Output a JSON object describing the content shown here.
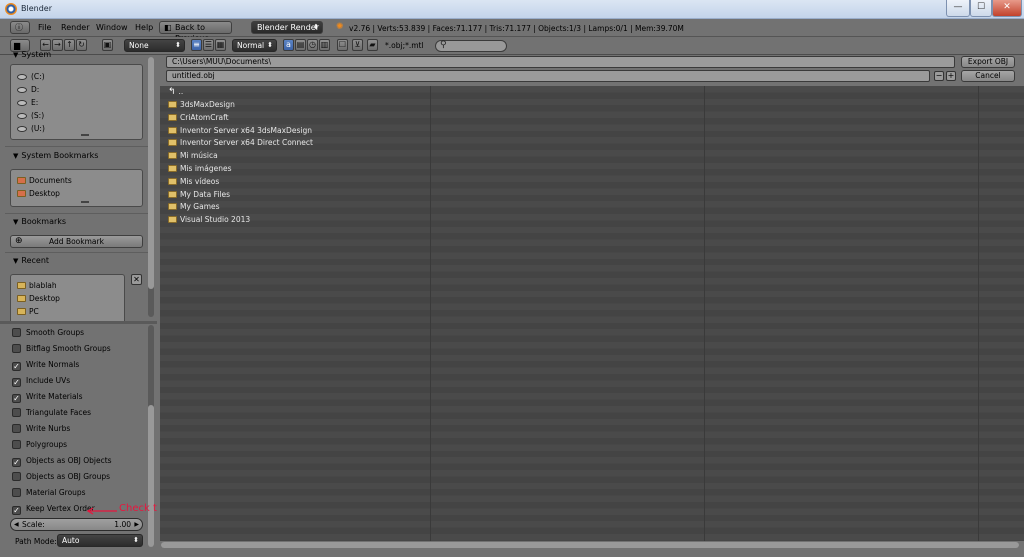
{
  "window": {
    "title": "Blender",
    "min": "—",
    "max": "☐",
    "close": "✕"
  },
  "info_header": {
    "menus": [
      "File",
      "Render",
      "Window",
      "Help"
    ],
    "back_button": "Back to Previous",
    "render_engine": "Blender Render",
    "stats": "v2.76 | Verts:53.839 | Faces:71.177 | Tris:71.177 | Objects:1/3 | Lamps:0/1 | Mem:39.70M"
  },
  "file_header": {
    "sort_select": "None",
    "display_select": "Normal",
    "filter_text": "*.obj;*.mtl",
    "search_placeholder": ""
  },
  "sidebar": {
    "volumes_header": "System",
    "drives": [
      "(C:)",
      "D:",
      "E:",
      "(S:)",
      "(U:)"
    ],
    "system_bookmarks_header": "System Bookmarks",
    "system_bookmarks": [
      "Documents",
      "Desktop"
    ],
    "bookmarks_header": "Bookmarks",
    "add_bookmark": "Add Bookmark",
    "recent_header": "Recent",
    "recent": [
      "blablah",
      "Desktop",
      "PC"
    ]
  },
  "options": [
    {
      "label": "Smooth Groups",
      "checked": false
    },
    {
      "label": "Bitflag Smooth Groups",
      "checked": false
    },
    {
      "label": "Write Normals",
      "checked": true
    },
    {
      "label": "Include UVs",
      "checked": true
    },
    {
      "label": "Write Materials",
      "checked": true
    },
    {
      "label": "Triangulate Faces",
      "checked": false
    },
    {
      "label": "Write Nurbs",
      "checked": false
    },
    {
      "label": "Polygroups",
      "checked": false
    },
    {
      "label": "Objects as OBJ Objects",
      "checked": true
    },
    {
      "label": "Objects as OBJ Groups",
      "checked": false
    },
    {
      "label": "Material Groups",
      "checked": false
    },
    {
      "label": "Keep Vertex Order",
      "checked": true
    }
  ],
  "scale": {
    "label": "Scale:",
    "value": "1.00"
  },
  "path_mode": {
    "label": "Path Mode:",
    "value": "Auto"
  },
  "annotation": "Check this",
  "file_browser": {
    "directory": "C:\\Users\\MUU\\Documents\\",
    "filename": "untitled.obj",
    "export_button": "Export OBJ",
    "cancel_button": "Cancel",
    "parent_label": "..",
    "folders": [
      "3dsMaxDesign",
      "CriAtomCraft",
      "Inventor Server x64 3dsMaxDesign",
      "Inventor Server x64 Direct Connect",
      "Mi música",
      "Mis imágenes",
      "Mis vídeos",
      "My Data Files",
      "My Games",
      "Visual Studio 2013"
    ]
  }
}
